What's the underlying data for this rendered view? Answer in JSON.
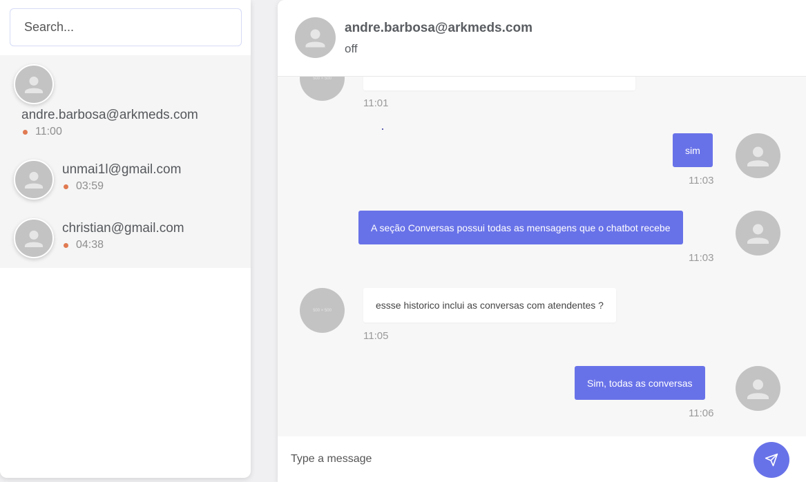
{
  "sidebar": {
    "search": {
      "placeholder": "Search..."
    },
    "contacts": [
      {
        "name": "andre.barbosa@arkmeds.com",
        "time": "11:00",
        "status_color": "#e07a52"
      },
      {
        "name": "unmai1l@gmail.com",
        "time": "03:59",
        "status_color": "#e07a52"
      },
      {
        "name": "christian@gmail.com",
        "time": "04:38",
        "status_color": "#e07a52"
      }
    ]
  },
  "chat": {
    "header": {
      "name": "andre.barbosa@arkmeds.com",
      "status": "off"
    },
    "avatar_placeholder_text": "500 × 500",
    "messages": [
      {
        "direction": "in",
        "text": "",
        "time": "11:01"
      },
      {
        "direction": "out",
        "text": "sim",
        "time": "11:03"
      },
      {
        "direction": "out",
        "text": "A seção Conversas possui todas as mensagens que o chatbot recebe",
        "time": "11:03"
      },
      {
        "direction": "in",
        "text": "essse historico inclui as conversas com atendentes ?",
        "time": "11:05"
      },
      {
        "direction": "out",
        "text": "Sim, todas as conversas",
        "time": "11:06"
      }
    ],
    "composer": {
      "placeholder": "Type a message"
    }
  },
  "colors": {
    "accent": "#6872e8",
    "status_dot": "#e07a52",
    "avatar_gray": "#c3c3c3",
    "incoming_bubble": "#ffffff"
  },
  "icons": {
    "avatar": "person-silhouette-icon",
    "send": "paper-plane-icon"
  }
}
